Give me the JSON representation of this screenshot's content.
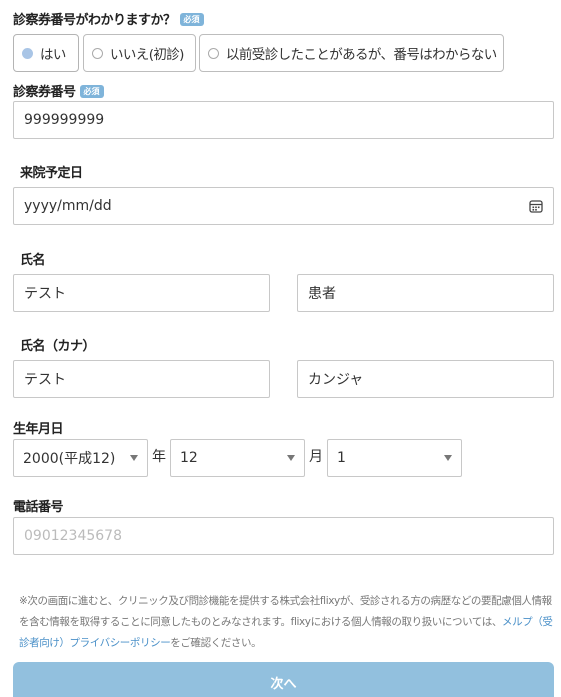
{
  "ticket_known": {
    "label": "診察券番号がわかりますか？",
    "required_badge": "必須",
    "options": [
      {
        "label": "はい",
        "selected": true
      },
      {
        "label": "いいえ(初診)",
        "selected": false
      },
      {
        "label": "以前受診したことがあるが、番号はわからない",
        "selected": false
      }
    ]
  },
  "ticket_number": {
    "label": "診察券番号",
    "required_badge": "必須",
    "value": "999999999"
  },
  "visit_date": {
    "label": "来院予定日",
    "value": "yyyy/mm/dd",
    "icon": "calendar-icon"
  },
  "name": {
    "label": "氏名",
    "last": "テスト",
    "first": "患者"
  },
  "name_kana": {
    "label": "氏名（カナ）",
    "last": "テスト",
    "first": "カンジャ"
  },
  "birthdate": {
    "label": "生年月日",
    "year": "2000(平成12)",
    "year_unit": "年",
    "month": "12",
    "month_unit": "月",
    "day": "1"
  },
  "phone": {
    "label": "電話番号",
    "placeholder": "09012345678"
  },
  "notice": {
    "text_before": "※次の画面に進むと、クリニック及び問診機能を提供する株式会社flixyが、受診される方の病歴などの要配慮個人情報を含む情報を取得することに同意したものとみなされます。flixyにおける個人情報の取り扱いについては、",
    "link": "メルプ（受診者向け）プライバシーポリシー",
    "text_after": "をご確認ください。"
  },
  "next_button": {
    "label": "次へ"
  },
  "colors": {
    "accent": "#92c0de",
    "badge": "#7fb4da",
    "link": "#4a90c8"
  }
}
